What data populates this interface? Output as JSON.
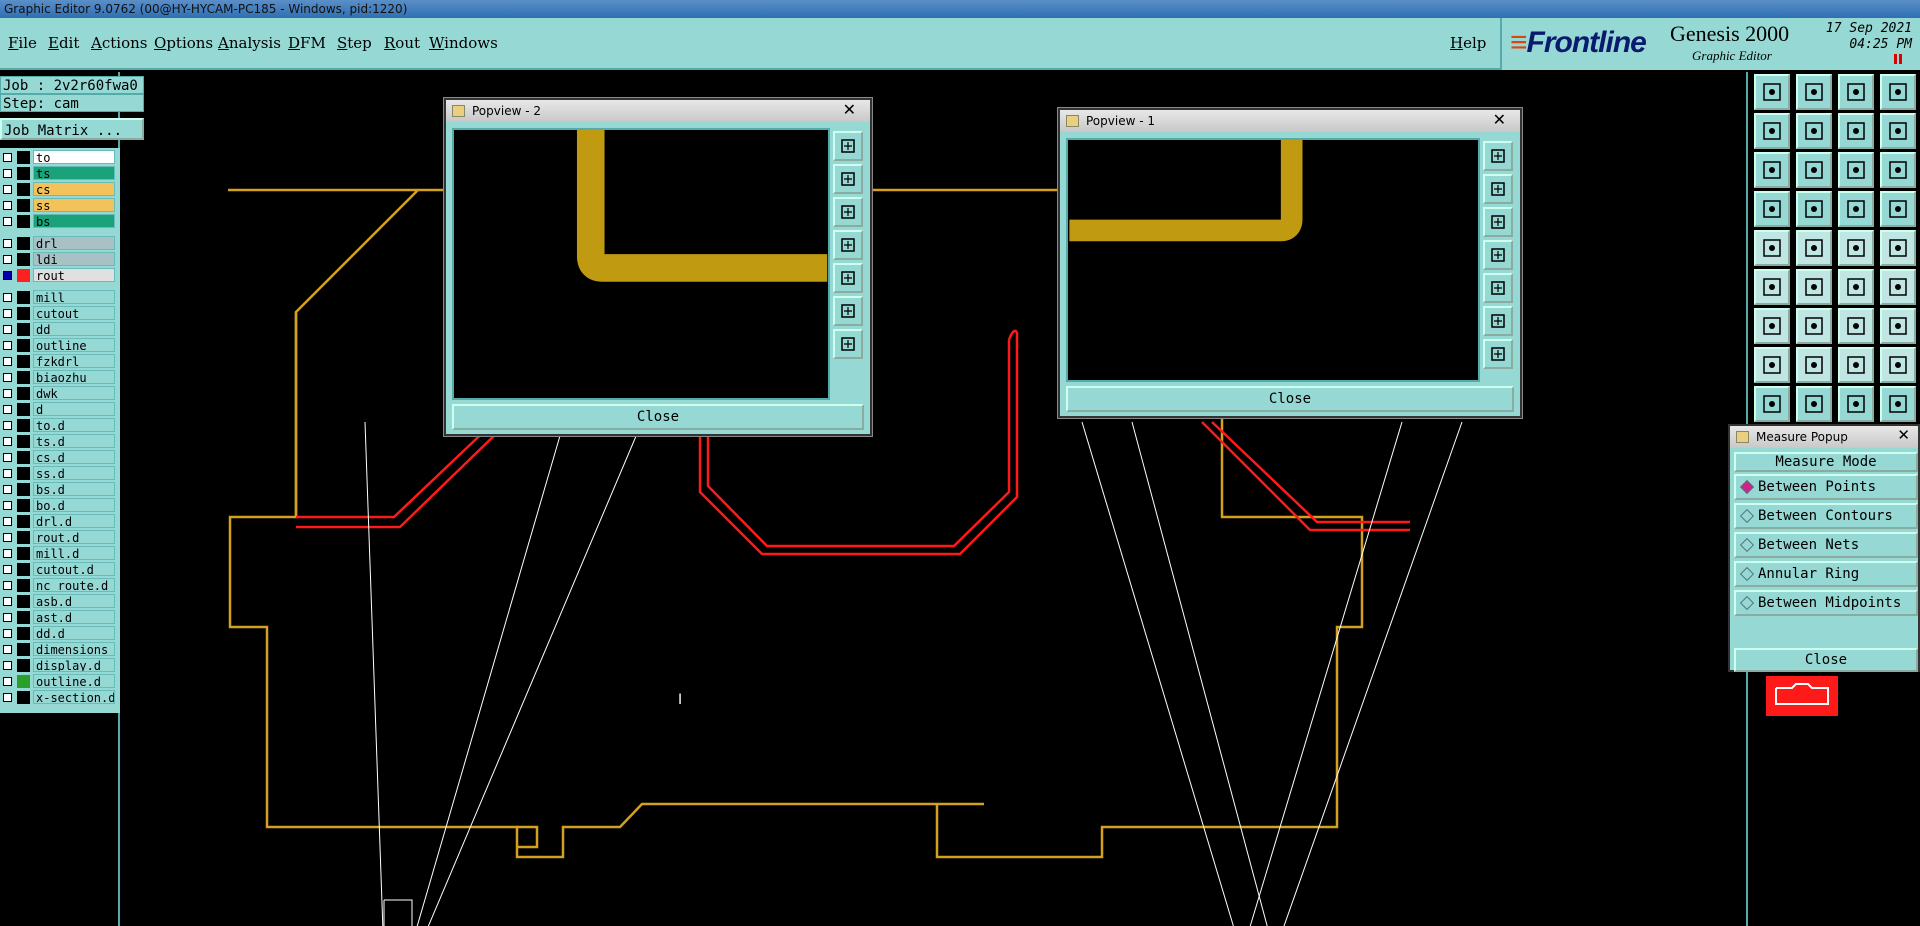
{
  "window": {
    "title": "Graphic Editor 9.0762 (00@HY-HYCAM-PC185 - Windows, pid:1220)"
  },
  "menu": {
    "items": [
      "File",
      "Edit",
      "Actions",
      "Options",
      "Analysis",
      "DFM",
      "Step",
      "Rout",
      "Windows"
    ],
    "help": "Help"
  },
  "logo": {
    "brand": "Frontline",
    "product": "Genesis 2000",
    "subtitle": "Graphic Editor",
    "date": "17 Sep 2021",
    "time": "04:25 PM"
  },
  "job": {
    "job_line": "Job : 2v2r60fwa0",
    "step_line": "Step: cam",
    "matrix_button": "Job Matrix ..."
  },
  "layers": [
    {
      "name": "to",
      "color": "#ffffff",
      "checked": false
    },
    {
      "name": "ts",
      "color": "#1aa37a",
      "checked": false
    },
    {
      "name": "cs",
      "color": "#f4c25a",
      "checked": false
    },
    {
      "name": "ss",
      "color": "#f4c25a",
      "checked": false
    },
    {
      "name": "bs",
      "color": "#1aa37a",
      "checked": false
    },
    {
      "name": "drl",
      "color": "#a7c1c5",
      "checked": false
    },
    {
      "name": "ldi",
      "color": "#a7c1c5",
      "checked": false
    },
    {
      "name": "rout",
      "color": "#e0e0e0",
      "checked": true,
      "swatch": "#ff2020"
    },
    {
      "name": "mill",
      "color": "#96d8d4",
      "checked": false
    },
    {
      "name": "cutout",
      "color": "#96d8d4",
      "checked": false
    },
    {
      "name": "dd",
      "color": "#96d8d4",
      "checked": false
    },
    {
      "name": "outline",
      "color": "#96d8d4",
      "checked": false
    },
    {
      "name": "fzkdrl",
      "color": "#96d8d4",
      "checked": false
    },
    {
      "name": "biaozhu",
      "color": "#96d8d4",
      "checked": false
    },
    {
      "name": "dwk",
      "color": "#96d8d4",
      "checked": false
    },
    {
      "name": "d",
      "color": "#96d8d4",
      "checked": false
    },
    {
      "name": "to.d",
      "color": "#96d8d4",
      "checked": false
    },
    {
      "name": "ts.d",
      "color": "#96d8d4",
      "checked": false
    },
    {
      "name": "cs.d",
      "color": "#96d8d4",
      "checked": false
    },
    {
      "name": "ss.d",
      "color": "#96d8d4",
      "checked": false
    },
    {
      "name": "bs.d",
      "color": "#96d8d4",
      "checked": false
    },
    {
      "name": "bo.d",
      "color": "#96d8d4",
      "checked": false
    },
    {
      "name": "drl.d",
      "color": "#96d8d4",
      "checked": false
    },
    {
      "name": "rout.d",
      "color": "#96d8d4",
      "checked": false
    },
    {
      "name": "mill.d",
      "color": "#96d8d4",
      "checked": false
    },
    {
      "name": "cutout.d",
      "color": "#96d8d4",
      "checked": false
    },
    {
      "name": "nc_route.d",
      "color": "#96d8d4",
      "checked": false
    },
    {
      "name": "asb.d",
      "color": "#96d8d4",
      "checked": false
    },
    {
      "name": "ast.d",
      "color": "#96d8d4",
      "checked": false
    },
    {
      "name": "dd.d",
      "color": "#96d8d4",
      "checked": false
    },
    {
      "name": "dimensions",
      "color": "#96d8d4",
      "checked": false
    },
    {
      "name": "display.d",
      "color": "#96d8d4",
      "checked": false
    },
    {
      "name": "outline.d",
      "color": "#96d8d4",
      "checked": false,
      "swatch": "#2aa02a"
    },
    {
      "name": "x-section.d",
      "color": "#96d8d4",
      "checked": false
    }
  ],
  "popview2": {
    "title": "Popview - 2",
    "close": "Close"
  },
  "popview1": {
    "title": "Popview - 1",
    "close": "Close"
  },
  "measure": {
    "title": "Measure Popup",
    "mode_header": "Measure Mode",
    "options": [
      "Between Points",
      "Between Contours",
      "Between Nets",
      "Annular Ring",
      "Between Midpoints"
    ],
    "selected": 0,
    "close": "Close"
  },
  "colors": {
    "board_outline": "#d4a020",
    "rout": "#ff1a1a",
    "panel": "#96d8d4",
    "trace": "#c09a10"
  }
}
